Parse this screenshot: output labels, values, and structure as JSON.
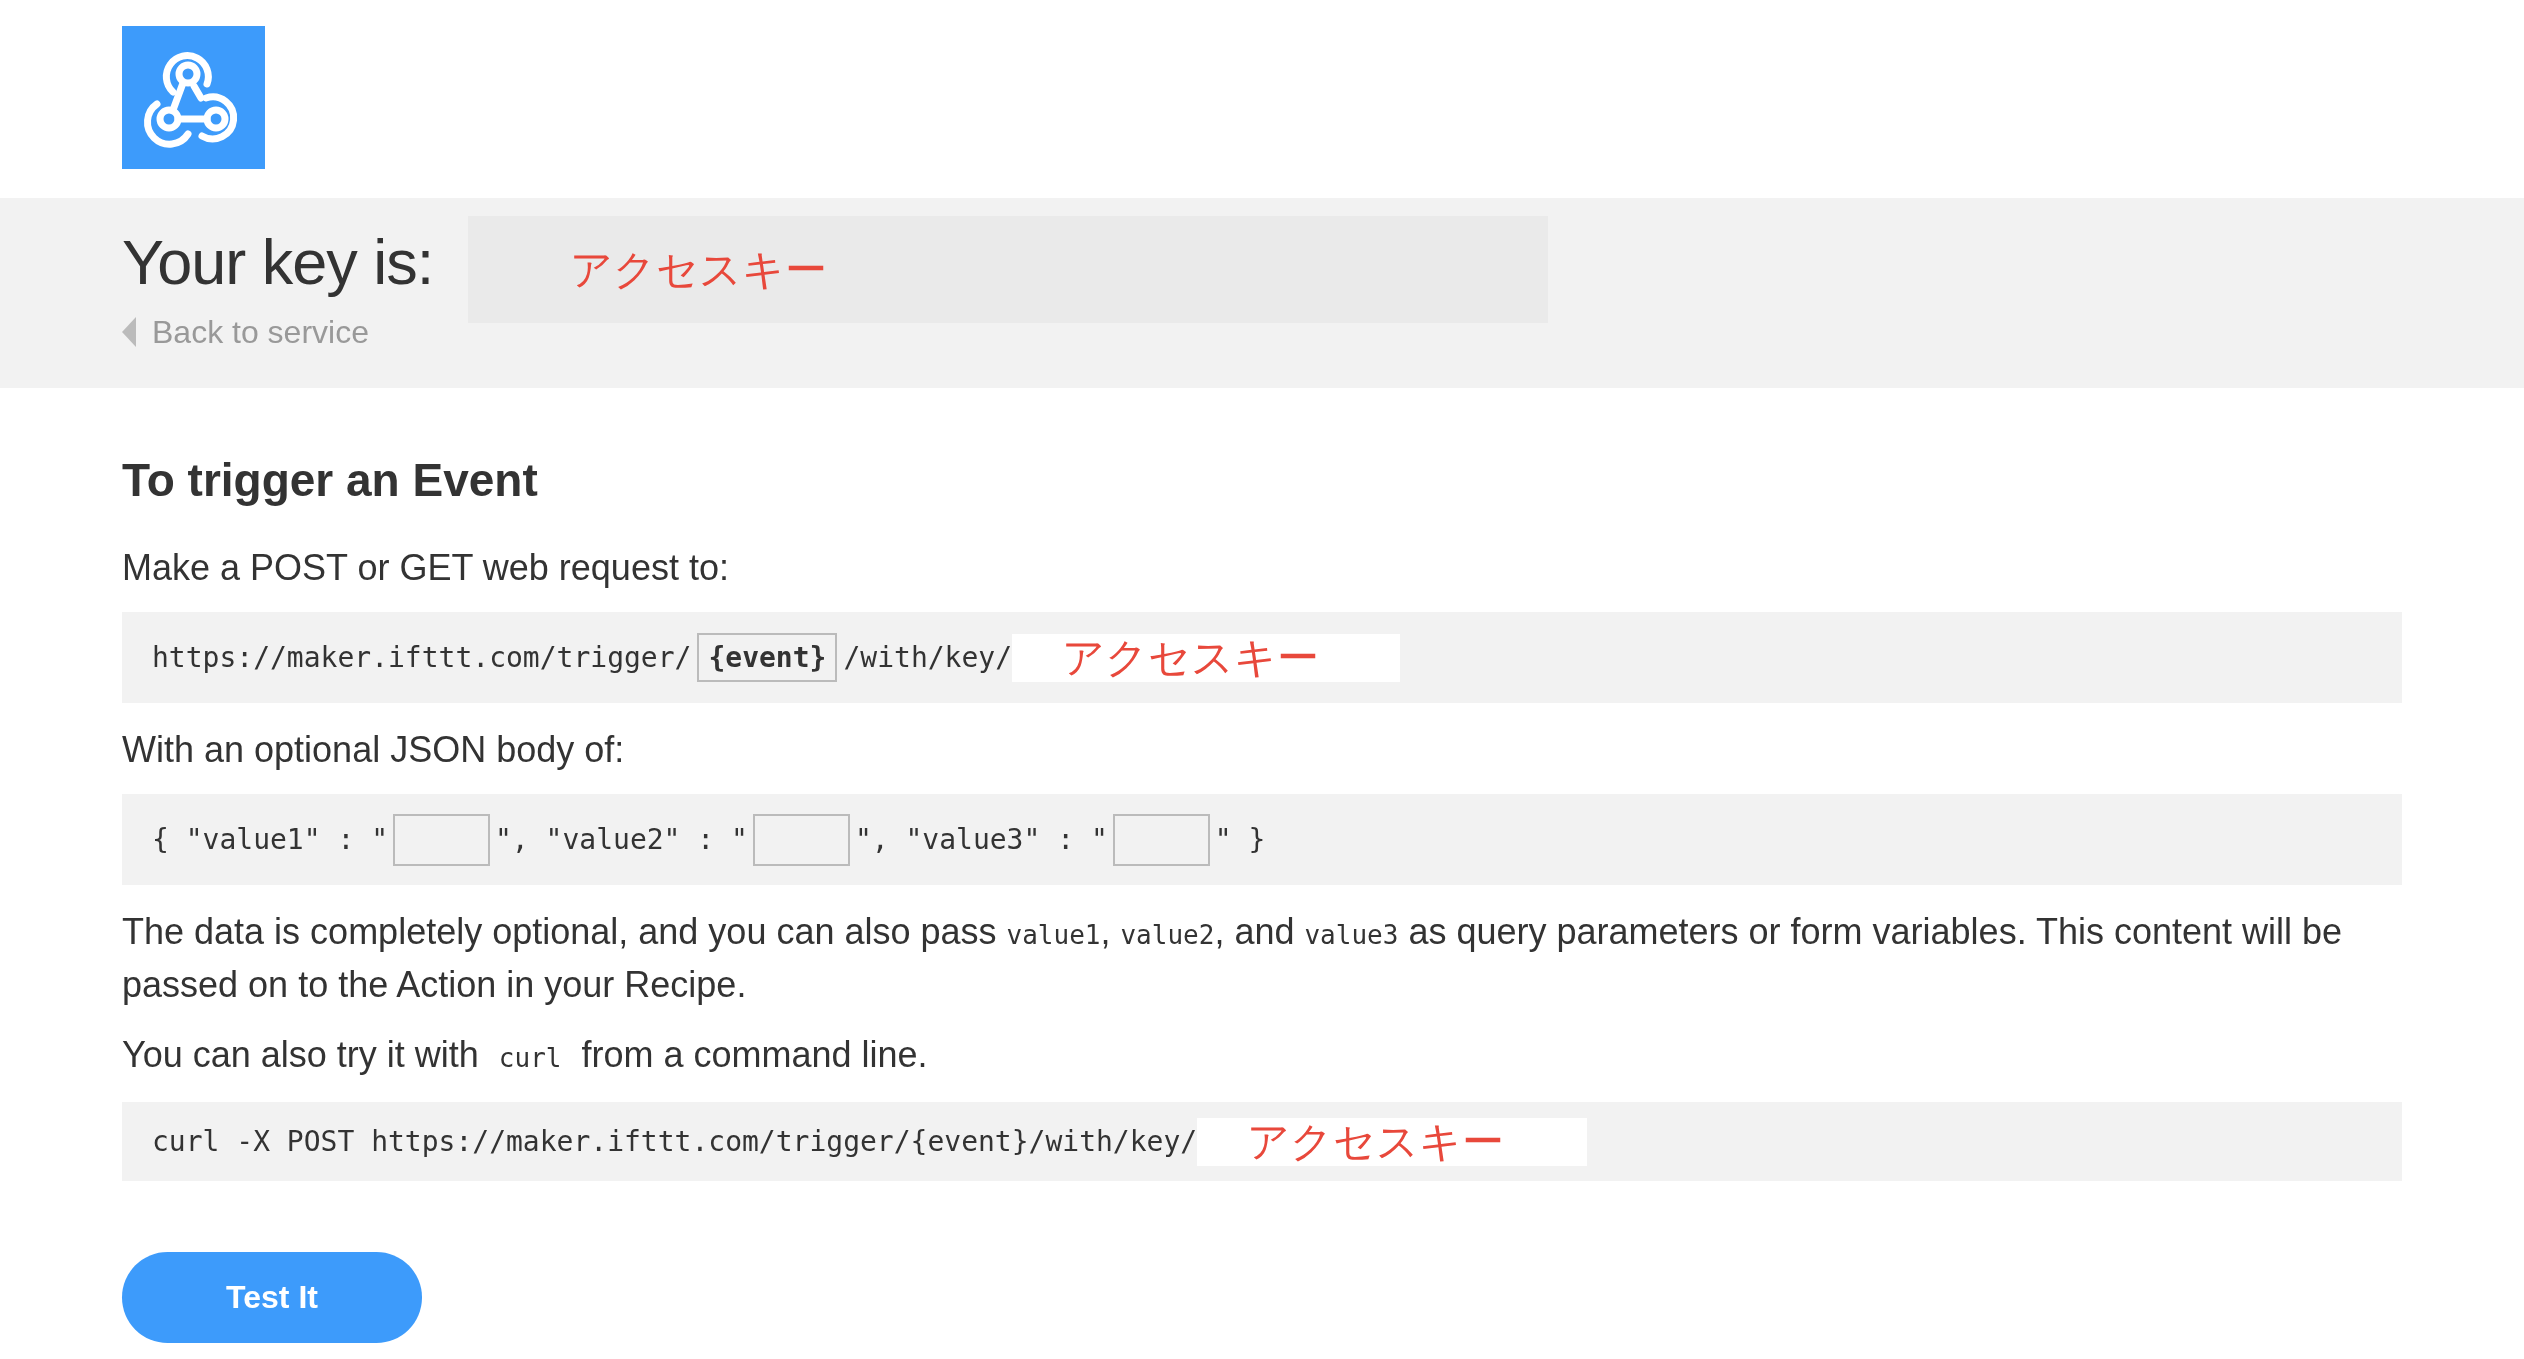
{
  "header": {
    "key_label": "Your key is:",
    "key_value": "アクセスキー",
    "back_link": "Back to service"
  },
  "trigger_section": {
    "heading": "To trigger an Event",
    "request_intro": "Make a POST or GET web request to:",
    "request_url": {
      "prefix": "https://maker.ifttt.com/trigger/",
      "event": "{event}",
      "path": "/with/key/",
      "key": "アクセスキー"
    },
    "body_intro": "With an optional JSON body of:",
    "json_body": {
      "fields": [
        {
          "prefix": "{ \"value1\" : \""
        },
        {
          "prefix": "\", \"value2\" : \""
        },
        {
          "prefix": "\", \"value3\" : \""
        }
      ],
      "suffix": "\" }"
    },
    "data_note": [
      {
        "kind": "text",
        "text": "The data is completely optional, and you can also pass "
      },
      {
        "kind": "code",
        "text": "value1"
      },
      {
        "kind": "text",
        "text": ", "
      },
      {
        "kind": "code",
        "text": "value2"
      },
      {
        "kind": "text",
        "text": ", and "
      },
      {
        "kind": "code",
        "text": "value3"
      },
      {
        "kind": "text",
        "text": " as query parameters or form variables. This content will be passed on to the Action in your Recipe."
      }
    ],
    "curl_intro": [
      {
        "kind": "text",
        "text": "You can also try it with "
      },
      {
        "kind": "code",
        "text": "curl"
      },
      {
        "kind": "text",
        "text": " from a command line."
      }
    ],
    "curl_command": {
      "command": "curl -X POST https://maker.ifttt.com/trigger/{event}/with/key/",
      "key": "アクセスキー"
    },
    "test_button": "Test It"
  }
}
